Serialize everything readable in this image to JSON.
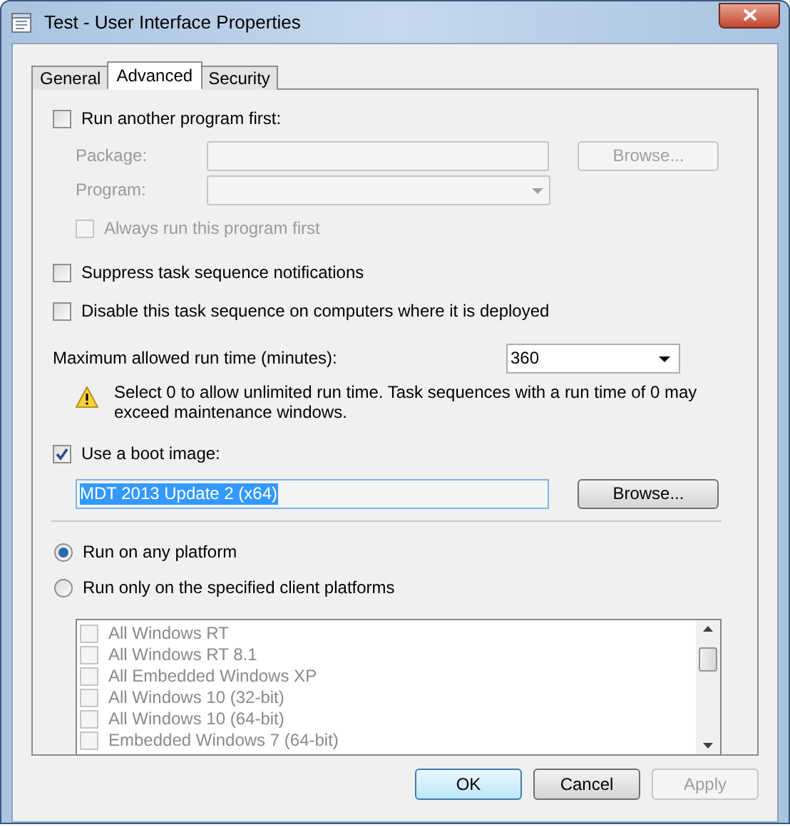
{
  "window": {
    "title": "Test - User Interface Properties"
  },
  "tabs": [
    {
      "label": "General",
      "selected": false
    },
    {
      "label": "Advanced",
      "selected": true
    },
    {
      "label": "Security",
      "selected": false
    }
  ],
  "run_another_program": {
    "label": "Run another program first:",
    "checked": false
  },
  "package": {
    "label": "Package:",
    "disabled": true,
    "browse_label": "Browse..."
  },
  "program": {
    "label": "Program:",
    "disabled": true
  },
  "always_run": {
    "label": "Always run this program first",
    "checked": false,
    "disabled": true
  },
  "options": [
    {
      "label": "Suppress task sequence notifications",
      "checked": false
    },
    {
      "label": "Disable this task sequence on computers where it is deployed",
      "checked": false
    }
  ],
  "max_run_time": {
    "label": "Maximum allowed run time (minutes):",
    "value": "360"
  },
  "warning": "Select 0 to allow unlimited run time. Task sequences with a run time of 0 may exceed maintenance windows.",
  "boot_image": {
    "label": "Use a boot image:",
    "checked": true,
    "value": "MDT 2013 Update 2 (x64)",
    "browse_label": "Browse..."
  },
  "platform_choices": [
    {
      "label": "Run on any platform",
      "selected": true
    },
    {
      "label": "Run only on the specified client platforms",
      "selected": false
    }
  ],
  "platforms": [
    {
      "label": "All Windows RT",
      "checked": false,
      "disabled": true
    },
    {
      "label": "All Windows RT 8.1",
      "checked": false,
      "disabled": true
    },
    {
      "label": "All Embedded Windows XP",
      "checked": false,
      "disabled": true
    },
    {
      "label": "All Windows 10 (32-bit)",
      "checked": false,
      "disabled": true
    },
    {
      "label": "All Windows 10 (64-bit)",
      "checked": false,
      "disabled": true
    },
    {
      "label": "Embedded Windows 7 (64-bit)",
      "checked": false,
      "disabled": true
    }
  ],
  "buttons": [
    {
      "label": "OK",
      "default": true,
      "disabled": false
    },
    {
      "label": "Cancel",
      "default": false,
      "disabled": false
    },
    {
      "label": "Apply",
      "default": false,
      "disabled": true
    }
  ]
}
